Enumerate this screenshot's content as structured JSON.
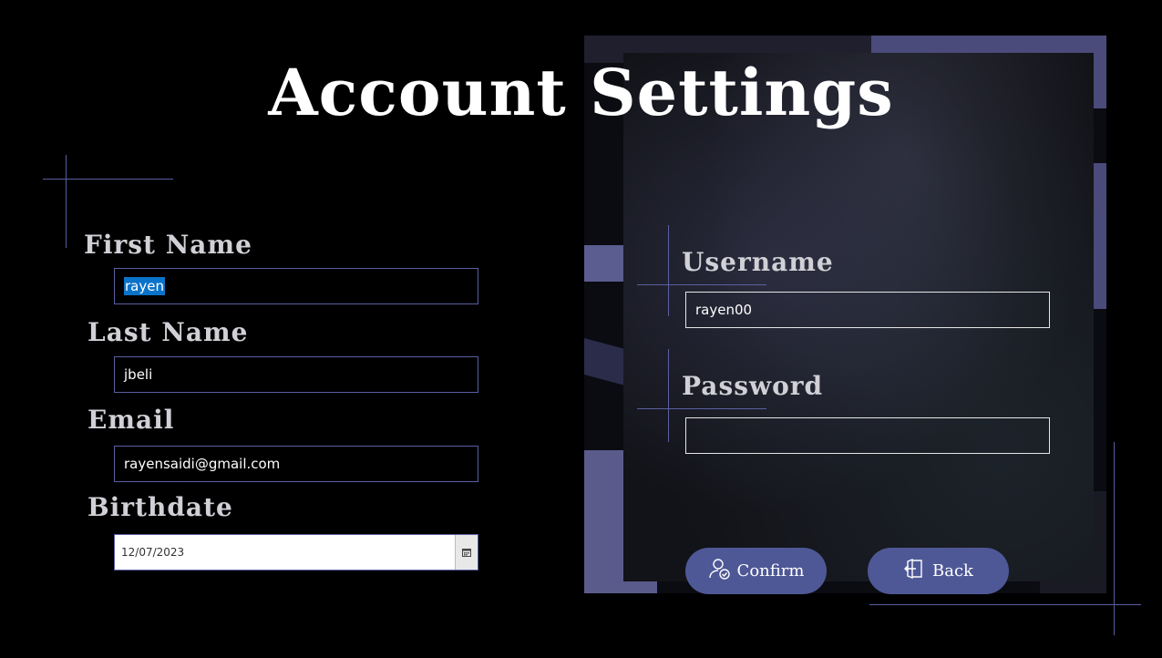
{
  "page": {
    "title": "Account Settings"
  },
  "personal": {
    "first_name": {
      "label": "First Name",
      "value": "rayen"
    },
    "last_name": {
      "label": "Last Name",
      "value": "jbeli"
    },
    "email": {
      "label": "Email",
      "value": "rayensaidi@gmail.com"
    },
    "birthdate": {
      "label": "Birthdate",
      "value": "12/07/2023"
    }
  },
  "credentials": {
    "username": {
      "label": "Username",
      "value": "rayen00"
    },
    "password": {
      "label": "Password",
      "value": ""
    }
  },
  "actions": {
    "confirm_label": "Confirm",
    "back_label": "Back"
  },
  "colors": {
    "accent": "#4e5896",
    "line": "#5a5fa0",
    "selection": "#0a73c9"
  },
  "icons": {
    "confirm": "user-check-icon",
    "back": "door-exit-icon",
    "calendar": "calendar-icon"
  }
}
